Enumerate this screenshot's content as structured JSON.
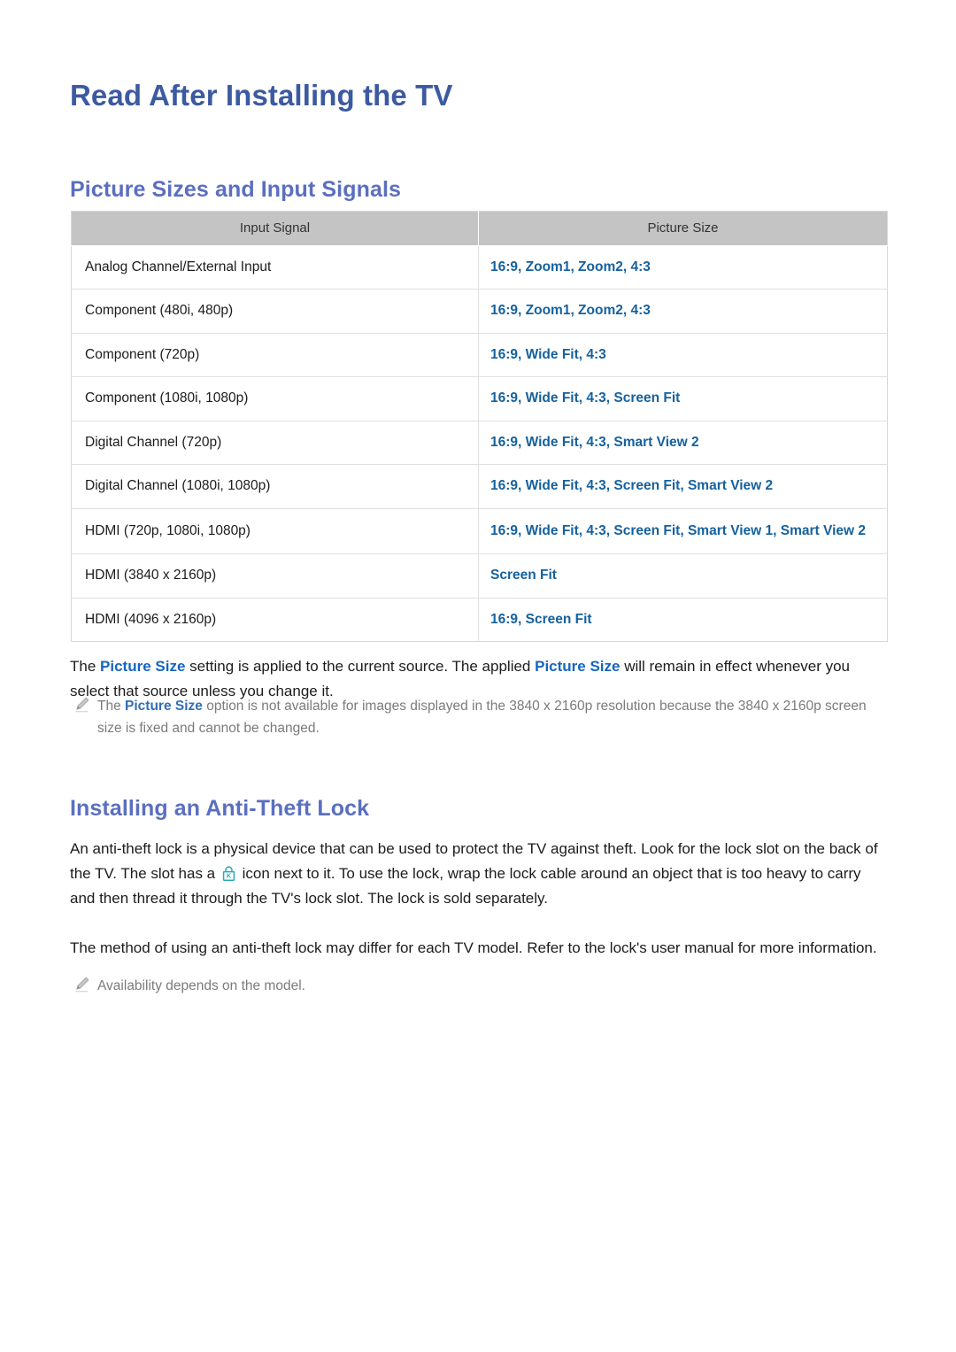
{
  "document": {
    "title": "Read After Installing the TV"
  },
  "sections": [
    {
      "id": "picture-sizes",
      "title": "Picture Sizes and Input Signals"
    },
    {
      "id": "anti-theft-lock",
      "title": "Installing an Anti-Theft Lock"
    }
  ],
  "table": {
    "headers": [
      "Input Signal",
      "Picture Size"
    ],
    "rows": [
      {
        "signal": "Analog Channel/External Input",
        "size": "16:9, Zoom1, Zoom2, 4:3"
      },
      {
        "signal": "Component (480i, 480p)",
        "size": "16:9, Zoom1, Zoom2, 4:3"
      },
      {
        "signal": "Component (720p)",
        "size": "16:9, Wide Fit, 4:3"
      },
      {
        "signal": "Component (1080i, 1080p)",
        "size": "16:9, Wide Fit, 4:3, Screen Fit"
      },
      {
        "signal": "Digital Channel (720p)",
        "size": "16:9, Wide Fit, 4:3, Smart View 2"
      },
      {
        "signal": "Digital Channel (1080i, 1080p)",
        "size": "16:9, Wide Fit, 4:3, Screen Fit, Smart View 2"
      },
      {
        "signal": "HDMI (720p, 1080i, 1080p)",
        "size": "16:9, Wide Fit, 4:3, Screen Fit, Smart View 1, Smart View 2"
      },
      {
        "signal": "HDMI (3840 x 2160p)",
        "size": "Screen Fit"
      },
      {
        "signal": "HDMI (4096 x 2160p)",
        "size": "16:9, Screen Fit"
      }
    ]
  },
  "paragraphs": {
    "picture_size_effect": {
      "part1": "The ",
      "keyword1": "Picture Size",
      "part2": " setting is applied to the current source. The applied ",
      "keyword2": "Picture Size",
      "part3": " will remain in effect whenever you select that source unless you change it."
    },
    "lock_description": {
      "part1": "An anti-theft lock is a physical device that can be used to protect the TV against theft. Look for the lock slot on the back of the TV. The slot has a ",
      "part2": " icon next to it. To use the lock, wrap the lock cable around an object that is too heavy to carry and then thread it through the TV's lock slot. The lock is sold separately."
    },
    "lock_method": {
      "text": "The method of using an anti-theft lock may differ for each TV model. Refer to the lock's user manual for more information."
    }
  },
  "notes": {
    "picture_size_unavailable": {
      "part1": "The ",
      "keyword1": "Picture Size",
      "part2": " option is not available for images displayed in the 3840 x 2160p resolution because the 3840 x 2160p screen size is fixed and cannot be changed."
    },
    "availability": {
      "text": "Availability depends on the model."
    }
  },
  "icons": {
    "note": "pencil-icon",
    "lock": "kensington-lock-icon"
  },
  "colors": {
    "page_title": "#3c5aa0",
    "section_title": "#5b6fc0",
    "table_header_bg": "#c4c4c4",
    "table_link": "#15619e",
    "keyword": "#1565c0",
    "note_text": "#7b7b7b",
    "lock_icon": "#2aa9b5"
  }
}
